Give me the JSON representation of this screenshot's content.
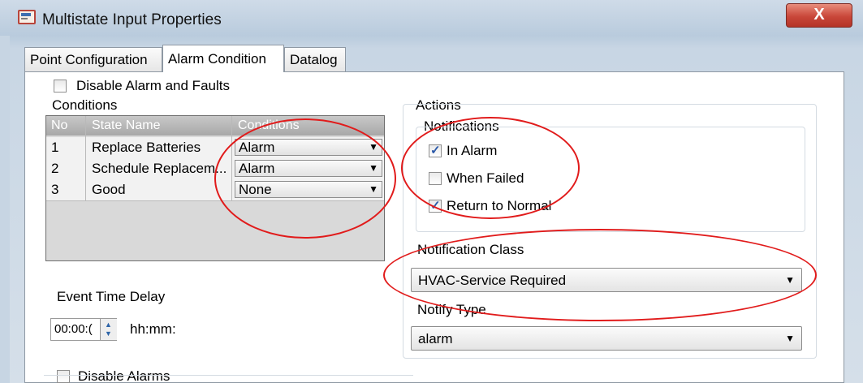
{
  "window": {
    "title": "Multistate Input Properties",
    "close_label": "X"
  },
  "tabs": [
    {
      "label": "Point Configuration"
    },
    {
      "label": "Alarm Condition"
    },
    {
      "label": "Datalog"
    }
  ],
  "alarm": {
    "disable_alarm_faults": "Disable Alarm and Faults",
    "conditions_label": "Conditions",
    "table": {
      "headers": [
        "No",
        "State Name",
        "Conditions"
      ],
      "rows": [
        {
          "no": "1",
          "state": "Replace Batteries",
          "condition": "Alarm"
        },
        {
          "no": "2",
          "state": "Schedule Replacem...",
          "condition": "Alarm"
        },
        {
          "no": "3",
          "state": "Good",
          "condition": "None"
        }
      ]
    },
    "event_time_delay": {
      "label": "Event Time Delay",
      "value": "00:00:(",
      "unit": "hh:mm:"
    },
    "disable_alarms": "Disable Alarms"
  },
  "actions": {
    "label": "Actions",
    "notifications": {
      "label": "Notifications",
      "items": [
        {
          "label": "In Alarm",
          "checked": true
        },
        {
          "label": "When Failed",
          "checked": false
        },
        {
          "label": "Return to Normal",
          "checked": true
        }
      ]
    },
    "notification_class": {
      "label": "Notification Class",
      "value": "HVAC-Service Required"
    },
    "notify_type": {
      "label": "Notify Type",
      "value": "alarm"
    }
  },
  "annotation_color": "#e11b1b"
}
